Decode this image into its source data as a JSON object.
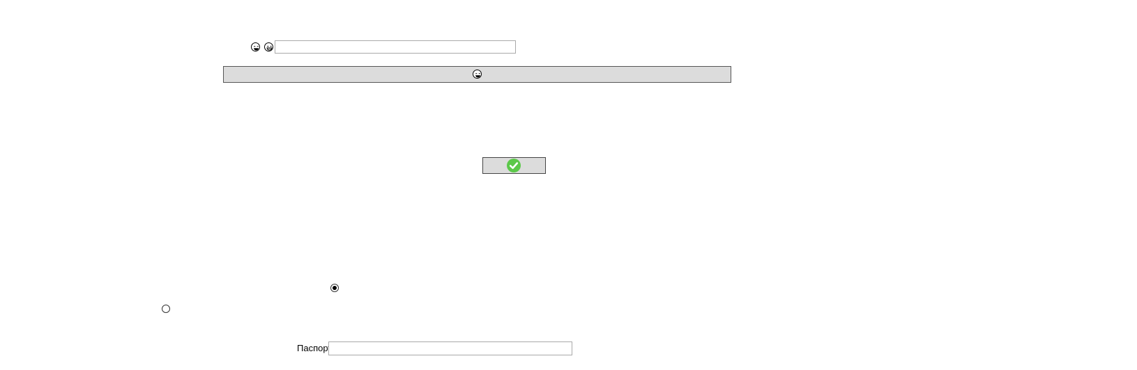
{
  "top_row": {
    "icons": [
      "laughing-face-icon",
      "grinning-face-icon"
    ],
    "input_value": "",
    "input_placeholder": ""
  },
  "wide_button": {
    "icon": "laughing-face-icon",
    "label": ""
  },
  "confirm_button": {
    "icon": "check-circle-icon",
    "icon_color": "#5cc84a",
    "label": ""
  },
  "radios": [
    {
      "checked": true
    },
    {
      "checked": false
    }
  ],
  "passport": {
    "label": "Паспорт",
    "value": "",
    "placeholder": ""
  }
}
